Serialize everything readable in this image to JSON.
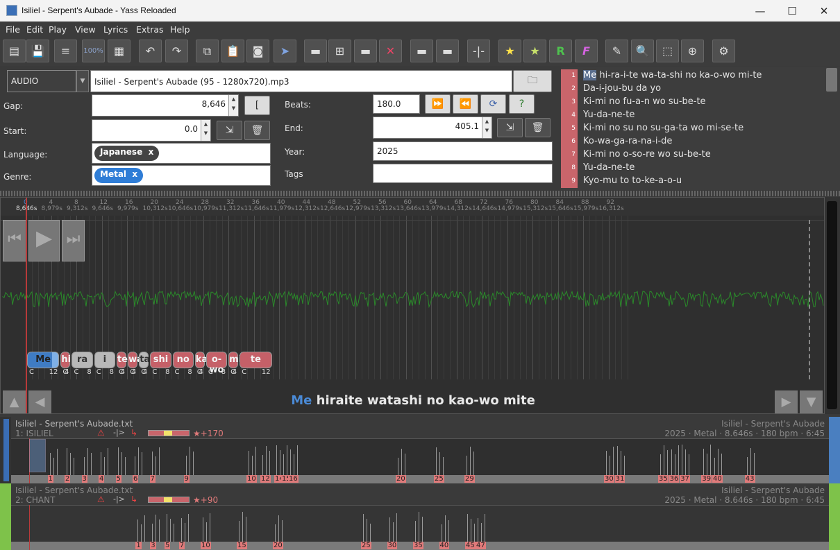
{
  "window": {
    "title": "Isiliel - Serpent's Aubade - Yass Reloaded"
  },
  "menu": [
    "File",
    "Edit",
    "Play",
    "View",
    "Lyrics",
    "Extras",
    "Help"
  ],
  "toolbar": {
    "icons": [
      "open-icon",
      "save-icon",
      "align-icon",
      "zoom-100-icon",
      "film-icon",
      "undo-icon",
      "redo-icon",
      "copy-icon",
      "paste-icon",
      "snapshot-icon",
      "select-icon",
      "note-minus-icon",
      "split-icon",
      "note-plus-icon",
      "remove-icon",
      "left-icon",
      "right-icon",
      "pipe-icon",
      "golden-icon",
      "rap-golden-icon",
      "rap-icon",
      "freestyle-icon",
      "edit-icon",
      "search-icon",
      "crop-icon",
      "zoom-icon",
      "settings-icon"
    ],
    "zoom_label": "100%"
  },
  "panel": {
    "type_value": "AUDIO",
    "file_value": "Isiliel - Serpent's Aubade (95 - 1280x720).mp3",
    "gap_label": "Gap:",
    "gap_value": "8,646",
    "start_label": "Start:",
    "start_value": "0.0",
    "language_label": "Language:",
    "language_chip": "Japanese",
    "genre_label": "Genre:",
    "genre_chip": "Metal",
    "beats_label": "Beats:",
    "beats_value": "180.0",
    "end_label": "End:",
    "end_value": "405.1",
    "year_label": "Year:",
    "year_value": "2025",
    "tags_label": "Tags",
    "tags_value": "",
    "chip_close": "x"
  },
  "lyrics": [
    {
      "num": "1",
      "text": "Me hi-ra-i-te wa-ta-shi no ka-o-wo mi-te",
      "hl": "Me"
    },
    {
      "num": "2",
      "text": "Da-i-jou-bu da yo"
    },
    {
      "num": "3",
      "text": "Ki-mi no fu-a-n wo su-be-te"
    },
    {
      "num": "4",
      "text": "Yu-da-ne-te"
    },
    {
      "num": "5",
      "text": "Ki-mi no su no su-ga-ta wo mi-se-te"
    },
    {
      "num": "6",
      "text": "Ko-wa-ga-ra-na-i-de"
    },
    {
      "num": "7",
      "text": "Ki-mi no o-so-re wo su-be-te"
    },
    {
      "num": "8",
      "text": "Yu-da-ne-te"
    },
    {
      "num": "9",
      "text": "Kyo-mu to to-ke-a-o-u"
    }
  ],
  "ruler": {
    "beats": [
      "0",
      "4",
      "8",
      "12",
      "16",
      "20",
      "24",
      "28",
      "32",
      "36",
      "40",
      "44",
      "48",
      "52",
      "56",
      "60",
      "64",
      "68",
      "72",
      "76",
      "80",
      "84",
      "88",
      "92"
    ],
    "times": [
      "8,646s",
      "8,979s",
      "9,312s",
      "9,646s",
      "9,979s",
      "10,312s",
      "10,646s",
      "10,979s",
      "11,312s",
      "11,646s",
      "11,979s",
      "12,312s",
      "12,646s",
      "12,979s",
      "13,312s",
      "13,646s",
      "13,979s",
      "14,312s",
      "14,646s",
      "14,979s",
      "15,312s",
      "15,646s",
      "15,979s",
      "16,312s"
    ]
  },
  "notes": [
    {
      "text": "Me",
      "len": "12",
      "kind": "b"
    },
    {
      "text": "hi",
      "len": "4",
      "kind": "r"
    },
    {
      "text": "ra",
      "len": "8",
      "kind": "g"
    },
    {
      "text": "i",
      "len": "8",
      "kind": "g"
    },
    {
      "text": "te",
      "len": "4",
      "kind": "r"
    },
    {
      "text": "wa",
      "len": "4",
      "kind": "r"
    },
    {
      "text": "ta",
      "len": "4",
      "kind": "g"
    },
    {
      "text": "shi",
      "len": "8",
      "kind": "r"
    },
    {
      "text": "no",
      "len": "8",
      "kind": "r"
    },
    {
      "text": "ka",
      "len": "4",
      "kind": "r"
    },
    {
      "text": "o-wo",
      "len": "8",
      "kind": "r"
    },
    {
      "text": "mi",
      "len": "4",
      "kind": "r"
    },
    {
      "text": "te",
      "len": "12",
      "kind": "r"
    }
  ],
  "note_start_marker": "C",
  "current_line": {
    "highlight": "Me",
    "rest": "hiraite watashi no kao-wo mite"
  },
  "tracks": [
    {
      "file": "Isiliel - Serpent's Aubade.txt",
      "name": "1: ISILIEL",
      "artist_title": "Isiliel - Serpent's Aubade",
      "meta": "2025 · Metal · 8.646s · 180 bpm · 6:45",
      "score": "★+170",
      "color": "#4a7fc0",
      "nums": [
        "1",
        "2",
        "3",
        "4",
        "5",
        "6",
        "7",
        "9",
        "10",
        "12",
        "14",
        "15",
        "16",
        "20",
        "25",
        "29",
        "30",
        "31",
        "35",
        "36",
        "37",
        "39",
        "40",
        "43"
      ]
    },
    {
      "file": "Isiliel - Serpent's Aubade.txt",
      "name": "2: CHANT",
      "artist_title": "Isiliel - Serpent's Aubade",
      "meta": "2025 · Metal · 8.646s · 180 bpm · 6:45",
      "score": "★+90",
      "color": "#7ec24a",
      "nums": [
        "1",
        "3",
        "5",
        "7",
        "10",
        "15",
        "20",
        "25",
        "30",
        "35",
        "40",
        "45",
        "47"
      ]
    }
  ]
}
